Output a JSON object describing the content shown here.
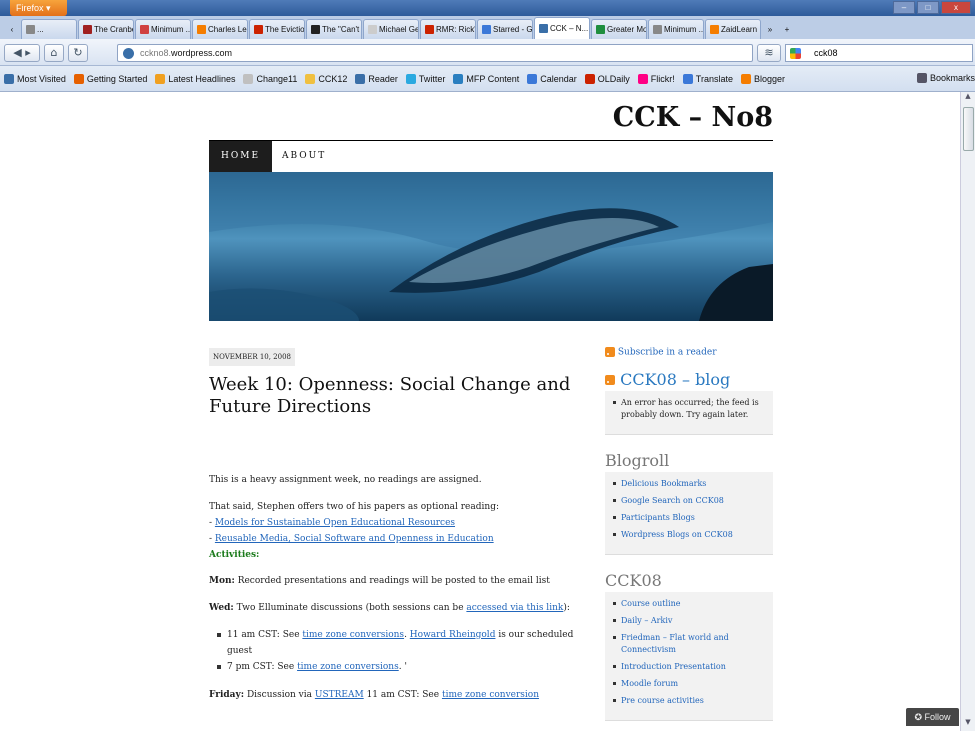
{
  "browser": {
    "app_button": "Firefox",
    "tabs": [
      {
        "label": "...",
        "color": "#888888"
      },
      {
        "label": "The Cranbe...",
        "color": "#a02020"
      },
      {
        "label": "Minimum ...",
        "color": "#d04040"
      },
      {
        "label": "Charles Lebl...",
        "color": "#f57d00"
      },
      {
        "label": "The Evictio...",
        "color": "#cc2200"
      },
      {
        "label": "The \"Can't ...",
        "color": "#222222"
      },
      {
        "label": "Michael Gei...",
        "color": "#cccccc"
      },
      {
        "label": "RMR: Rick's ...",
        "color": "#cc2200"
      },
      {
        "label": "Starred - Go...",
        "color": "#3b78d8"
      },
      {
        "label": "CCK – N...",
        "color": "#3a6fa8",
        "active": true
      },
      {
        "label": "Greater Mo...",
        "color": "#1e8e3e"
      },
      {
        "label": "Minimum ...",
        "color": "#888888"
      },
      {
        "label": "ZaidLearn",
        "color": "#f57d00"
      }
    ],
    "url_prefix": "cckno8.",
    "url_domain": "wordpress.com",
    "search_value": "cck08",
    "bookmarks": [
      {
        "label": "Most Visited",
        "color": "#3a6fa8"
      },
      {
        "label": "Getting Started",
        "color": "#e66000"
      },
      {
        "label": "Latest Headlines",
        "color": "#f0a020"
      },
      {
        "label": "Change11",
        "color": "#c0c0c0"
      },
      {
        "label": "CCK12",
        "color": "#f0c040"
      },
      {
        "label": "Reader",
        "color": "#3a6fa8"
      },
      {
        "label": "Twitter",
        "color": "#2aa9e0"
      },
      {
        "label": "MFP Content",
        "color": "#2a7fc0"
      },
      {
        "label": "Calendar",
        "color": "#3b78d8"
      },
      {
        "label": "OLDaily",
        "color": "#cc2200"
      },
      {
        "label": "Flickr!",
        "color": "#ff0084"
      },
      {
        "label": "Translate",
        "color": "#3b78d8"
      },
      {
        "label": "Blogger",
        "color": "#f57d00"
      }
    ],
    "bookmarks_menu": "Bookmarks"
  },
  "site": {
    "title": "CCK – No8",
    "nav": {
      "home": "HOME",
      "about": "ABOUT"
    }
  },
  "post": {
    "date": "NOVEMBER 10, 2008",
    "title": "Week 10: Openness: Social Change and Future Directions",
    "intro": "This is a heavy assignment week, no readings are assigned.",
    "optional": "That said, Stephen offers two of his papers as optional reading:",
    "link1_prefix": "- ",
    "link1": "Models for Sustainable Open Educational Resources",
    "link2_prefix": "- ",
    "link2": "Reusable Media, Social Software and Openness in Education",
    "activities": "Activities:",
    "mon_label": "Mon:",
    "mon_text": " Recorded presentations and readings will be posted to the email list",
    "wed_label": "Wed:",
    "wed_text": " Two Elluminate discussions (both sessions can be ",
    "wed_link": "accessed via this link",
    "wed_end": "):",
    "item1_prefix": "11 am CST: See ",
    "item1_link": "time zone conversions",
    "item1_mid": ". ",
    "item1_link2": "Howard Rheingold",
    "item1_end": " is our scheduled guest",
    "item2_prefix": "7 pm CST: See ",
    "item2_link": "time zone conversions",
    "item2_end": ". '",
    "fri_label": "Friday:",
    "fri_text": " Discussion via ",
    "fri_link": "USTREAM",
    "fri_mid": " 11 am CST: See ",
    "fri_link2": "time zone conversion"
  },
  "sidebar": {
    "subscribe": "Subscribe in a reader",
    "feed_title": "CCK08 – blog",
    "feed_error": "An error has occurred; the feed is probably down. Try again later.",
    "blogroll_title": "Blogroll",
    "blogroll": [
      "Delicious Bookmarks",
      "Google Search on CCK08",
      "Participants Blogs",
      "Wordpress Blogs on CCK08"
    ],
    "cck_title": "CCK08",
    "cck": [
      "Course outline",
      "Daily – Arkiv",
      "Friedman – Flat world and Connectivism",
      "Introduction Presentation",
      "Moodle forum",
      "Pre course activities"
    ]
  },
  "follow": "Follow"
}
